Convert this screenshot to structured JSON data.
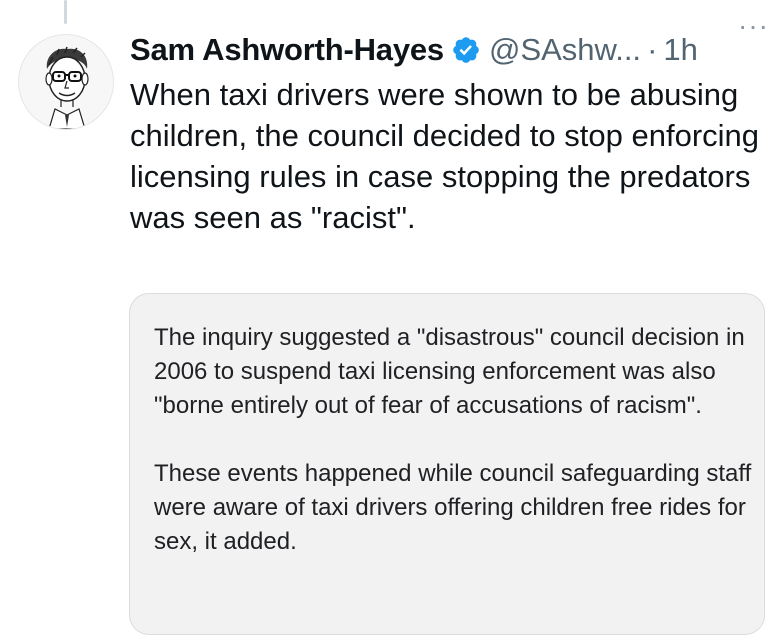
{
  "tweet": {
    "author_name": "Sam Ashworth-Hayes",
    "handle": "@SAshw...",
    "separator": "·",
    "time": "1h",
    "more_label": "···",
    "text": "When taxi drivers were shown to be abusing children, the council decided to stop enforcing licensing rules in case stopping the predators was seen as \"racist\".",
    "verified_color": "#1d9bf0",
    "avatar_icon": "caricature-portrait-icon",
    "verified_icon": "verified-badge-icon"
  },
  "quote": {
    "paragraph_1": "The inquiry suggested a \"disastrous\" council decision in 2006 to suspend taxi licensing enforcement was also \"borne entirely out of fear of accusations of racism\".",
    "paragraph_2": "These events happened while council safeguarding staff were aware of taxi drivers offering children free rides for sex, it added."
  }
}
